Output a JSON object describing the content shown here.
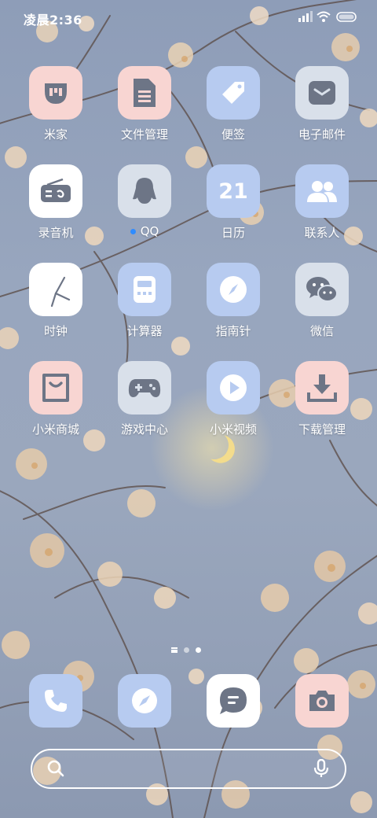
{
  "status_bar": {
    "time": "凌晨2:36"
  },
  "apps": [
    {
      "label": "米家",
      "icon": "mijia-icon",
      "tile": "pink"
    },
    {
      "label": "文件管理",
      "icon": "file-icon",
      "tile": "pink"
    },
    {
      "label": "便签",
      "icon": "tag-icon",
      "tile": "blue"
    },
    {
      "label": "电子邮件",
      "icon": "mail-icon",
      "tile": "gray"
    },
    {
      "label": "录音机",
      "icon": "radio-icon",
      "tile": "white"
    },
    {
      "label": "QQ",
      "icon": "penguin-icon",
      "tile": "gray",
      "new_install_dot": true
    },
    {
      "label": "日历",
      "icon": "calendar-icon",
      "tile": "blue",
      "icon_text": "21"
    },
    {
      "label": "联系人",
      "icon": "contacts-icon",
      "tile": "blue"
    },
    {
      "label": "时钟",
      "icon": "clock-icon",
      "tile": "white"
    },
    {
      "label": "计算器",
      "icon": "calculator-icon",
      "tile": "blue"
    },
    {
      "label": "指南针",
      "icon": "compass-icon",
      "tile": "blue"
    },
    {
      "label": "微信",
      "icon": "wechat-icon",
      "tile": "gray"
    },
    {
      "label": "小米商城",
      "icon": "shopping-bag-icon",
      "tile": "pink"
    },
    {
      "label": "游戏中心",
      "icon": "gamepad-icon",
      "tile": "gray"
    },
    {
      "label": "小米视频",
      "icon": "play-icon",
      "tile": "blue"
    },
    {
      "label": "下载管理",
      "icon": "download-icon",
      "tile": "pink"
    }
  ],
  "pager": {
    "pages": 2,
    "current_page": 2
  },
  "dock": [
    {
      "icon": "phone-icon",
      "tile": "blue"
    },
    {
      "icon": "browser-compass-icon",
      "tile": "blue"
    },
    {
      "icon": "message-icon",
      "tile": "white"
    },
    {
      "icon": "camera-icon",
      "tile": "pink"
    }
  ],
  "search_bar": {
    "left_icon": "search-icon",
    "right_icon": "microphone-icon"
  },
  "colors": {
    "pink_tile": "#f8d5d2",
    "blue_tile": "#b7cbf0",
    "gray_tile": "#d9e0ea",
    "icon_glyph": "#6d7586",
    "notification_dot": "#2f8cff"
  }
}
